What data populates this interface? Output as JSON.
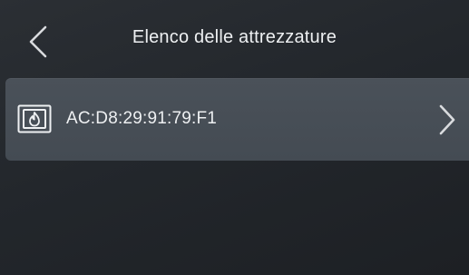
{
  "header": {
    "title": "Elenco delle attrezzature",
    "back_icon": "chevron-left-icon"
  },
  "devices": [
    {
      "label": "AC:D8:29:91:79:F1",
      "icon": "fireplace-icon",
      "action_icon": "chevron-right-icon"
    }
  ],
  "colors": {
    "background": "#25292e",
    "row": "#475057",
    "text": "#eef0f2"
  }
}
